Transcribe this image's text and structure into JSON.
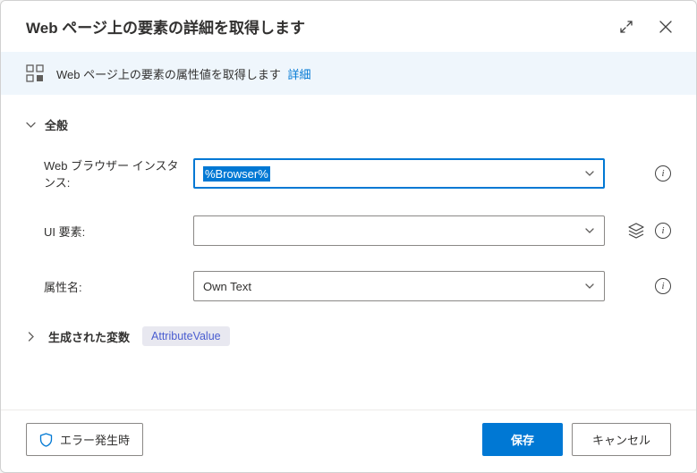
{
  "header": {
    "title": "Web ページ上の要素の詳細を取得します"
  },
  "info_bar": {
    "text": "Web ページ上の要素の属性値を取得します",
    "details_link": "詳細"
  },
  "sections": {
    "general": {
      "title": "全般",
      "fields": {
        "browser_instance": {
          "label": "Web ブラウザー インスタンス:",
          "value": "%Browser%"
        },
        "ui_element": {
          "label": "UI 要素:",
          "value": ""
        },
        "attribute_name": {
          "label": "属性名:",
          "value": "Own Text"
        }
      }
    },
    "generated_vars": {
      "title": "生成された変数",
      "chip": "AttributeValue"
    }
  },
  "footer": {
    "on_error": "エラー発生時",
    "save": "保存",
    "cancel": "キャンセル"
  }
}
